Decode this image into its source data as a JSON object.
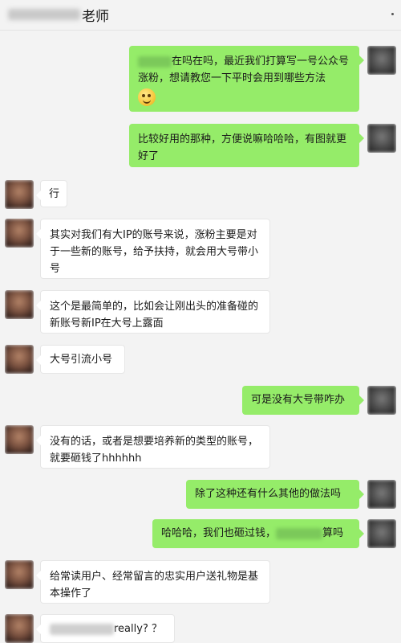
{
  "header": {
    "title_suffix": "老师",
    "more_icon": "more-dots-icon"
  },
  "messages": [
    {
      "side": "right",
      "lines_before_emoji": "在吗在吗，最近我们打算写一号公众号涨粉，想请教您一下平时会用到哪些方法",
      "emoji": "grimacing-emoji"
    },
    {
      "side": "right",
      "text": "比较好用的那种，方便说嘛哈哈哈，有图就更好了"
    },
    {
      "side": "left",
      "text": "行"
    },
    {
      "side": "left",
      "text": "其实对我们有大IP的账号来说，涨粉主要是对于一些新的账号，给予扶持，就会用大号带小号"
    },
    {
      "side": "left",
      "text": "这个是最简单的，比如会让刚出头的准备碰的新账号新IP在大号上露面"
    },
    {
      "side": "left",
      "text": "大号引流小号"
    },
    {
      "side": "right",
      "text": "可是没有大号带咋办"
    },
    {
      "side": "left",
      "text": "没有的话，或者是想要培养新的类型的账号，就要砸钱了hhhhhh"
    },
    {
      "side": "right",
      "text": "除了这种还有什么其他的做法吗"
    },
    {
      "side": "right",
      "text_before": "哈哈哈，我们也砸过钱，",
      "text_after": "算吗"
    },
    {
      "side": "left",
      "text": "给常读用户、经常留言的忠实用户送礼物是基本操作了"
    },
    {
      "side": "left",
      "text_after": "really? ？"
    }
  ]
}
